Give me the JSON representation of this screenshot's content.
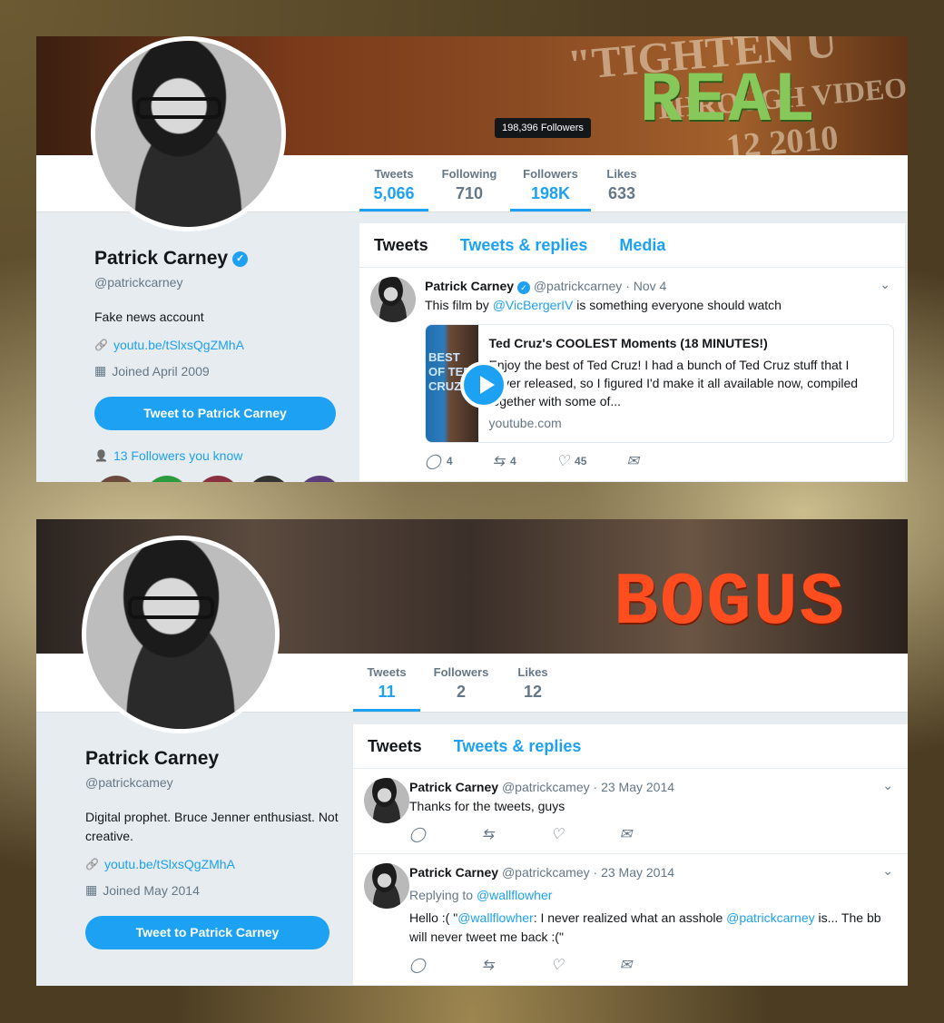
{
  "real": {
    "stamp": "REAL",
    "banner_text": [
      "\"TIGHTEN U",
      "THROUGH VIDEO",
      "12 2010"
    ],
    "tooltip": "198,396 Followers",
    "stats": [
      {
        "label": "Tweets",
        "value": "5,066"
      },
      {
        "label": "Following",
        "value": "710"
      },
      {
        "label": "Followers",
        "value": "198K"
      },
      {
        "label": "Likes",
        "value": "633"
      }
    ],
    "profile": {
      "name": "Patrick Carney",
      "handle": "@patrickcarney",
      "bio": "Fake news account",
      "link": "youtu.be/tSlxsQgZMhA",
      "joined": "Joined April 2009",
      "button": "Tweet to Patrick Carney",
      "followers_you_know": "13 Followers you know"
    },
    "tabs": [
      "Tweets",
      "Tweets & replies",
      "Media"
    ],
    "tweet": {
      "name": "Patrick Carney",
      "handle": "@patrickcarney",
      "date": "· Nov 4",
      "text_before": "This film by ",
      "mention": "@VicBergerIV",
      "text_after": " is something everyone should watch",
      "card": {
        "image_text": "BEST OF TED CRUZ",
        "title": "Ted Cruz's COOLEST Moments (18 MINUTES!)",
        "description": "Enjoy the best of Ted Cruz! I had a bunch of Ted Cruz stuff that I never released, so I figured I'd make it all available now, compiled together with some of...",
        "domain": "youtube.com"
      },
      "replies": "4",
      "retweets": "4",
      "likes": "45"
    }
  },
  "bogus": {
    "stamp": "BOGUS",
    "stats": [
      {
        "label": "Tweets",
        "value": "11"
      },
      {
        "label": "Followers",
        "value": "2"
      },
      {
        "label": "Likes",
        "value": "12"
      }
    ],
    "profile": {
      "name": "Patrick Carney",
      "handle": "@patrickcamey",
      "bio": "Digital prophet. Bruce Jenner enthusiast. Not creative.",
      "link": "youtu.be/tSlxsQgZMhA",
      "joined": "Joined May 2014",
      "button": "Tweet to Patrick Carney"
    },
    "tabs": [
      "Tweets",
      "Tweets & replies"
    ],
    "tweets": [
      {
        "name": "Patrick Carney",
        "handle": "@patrickcamey",
        "date": "· 23 May 2014",
        "text": "Thanks for the tweets, guys"
      },
      {
        "name": "Patrick Carney",
        "handle": "@patrickcamey",
        "date": "· 23 May 2014",
        "replying_prefix": "Replying to ",
        "replying_to": "@wallflowher",
        "text_a": "Hello :( \"",
        "mention_a": "@wallflowher",
        "text_b": ": I never realized what an asshole ",
        "mention_b": "@patrickcarney",
        "text_c": " is... The bb will never tweet me back :(\""
      }
    ]
  },
  "icons": {
    "verified": "✓",
    "caret": "⌄",
    "link": "🔗",
    "calendar": "▦",
    "person": "👤",
    "reply": "◯",
    "retweet": "⇆",
    "like": "♡",
    "dm": "✉"
  },
  "colors": {
    "accent": "#1da1f2",
    "real_stamp": "#86c85a",
    "bogus_stamp": "#ff4d1f"
  }
}
